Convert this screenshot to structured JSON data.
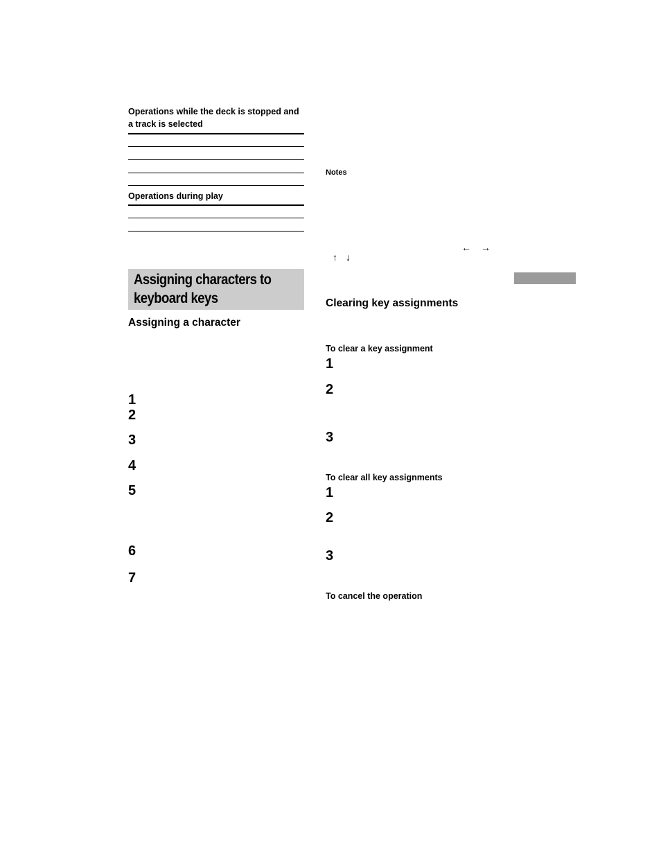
{
  "left_column": {
    "table_stopped": {
      "heading": "Operations while the deck is stopped and a track is selected",
      "row_count": 4
    },
    "table_play": {
      "heading": "Operations during play",
      "row_count": 2
    },
    "section_title": [
      "Assigning characters to",
      "keyboard keys"
    ],
    "subsection": "Assigning a character",
    "steps": [
      "1",
      "2",
      "3",
      "4",
      "5",
      "6",
      "7"
    ]
  },
  "right_column": {
    "notes_label": "Notes",
    "arrows": {
      "left": "←",
      "right": "→",
      "up": "↑",
      "down": "↓"
    },
    "side_tab_color": "#9b9b9b",
    "section_heading": "Clearing key assignments",
    "clear_one": {
      "heading": "To clear a key assignment",
      "steps": [
        "1",
        "2",
        "3"
      ]
    },
    "clear_all": {
      "heading": "To clear all key assignments",
      "steps": [
        "1",
        "2",
        "3"
      ]
    },
    "cancel_heading": "To cancel the operation"
  }
}
